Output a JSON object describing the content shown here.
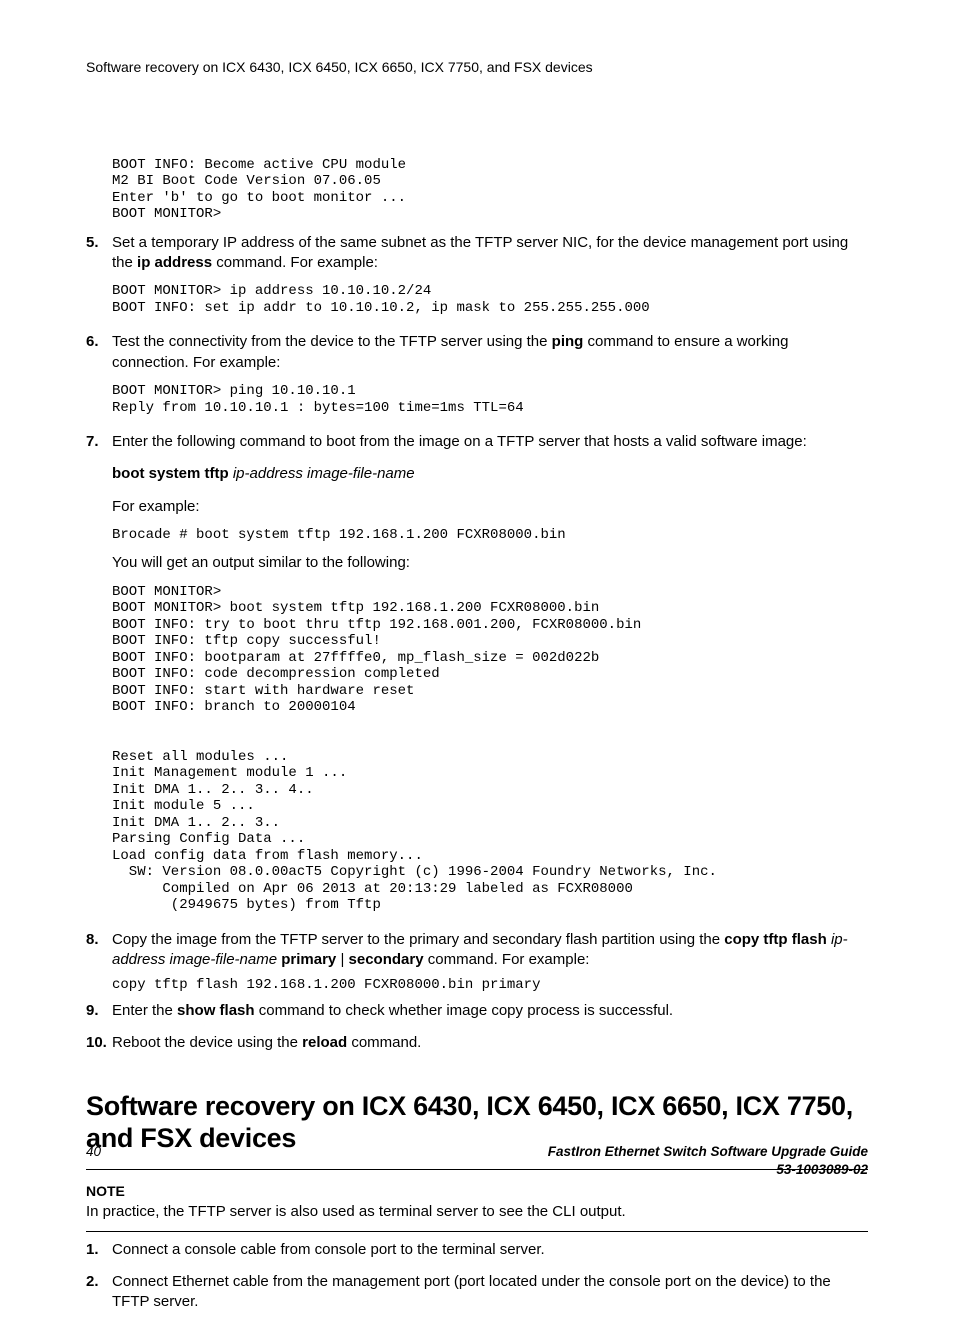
{
  "runningHead": "Software recovery on ICX 6430, ICX 6450, ICX 6650, ICX 7750, and FSX devices",
  "preIntro": "BOOT INFO: Become active CPU module\nM2 BI Boot Code Version 07.06.05\nEnter 'b' to go to boot monitor ...\nBOOT MONITOR>",
  "step5": {
    "num": "5.",
    "text_a": "Set a temporary IP address of the same subnet as the TFTP server NIC, for the device management port using the ",
    "bold_a": "ip address",
    "text_b": " command. For example:",
    "pre": "BOOT MONITOR> ip address 10.10.10.2/24\nBOOT INFO: set ip addr to 10.10.10.2, ip mask to 255.255.255.000"
  },
  "step6": {
    "num": "6.",
    "text_a": "Test the connectivity from the device to the TFTP server using the ",
    "bold_a": "ping",
    "text_b": " command to ensure a working connection. For example:",
    "pre": "BOOT MONITOR> ping 10.10.10.1\nReply from 10.10.10.1 : bytes=100 time=1ms TTL=64"
  },
  "step7": {
    "num": "7.",
    "p1": "Enter the following command to boot from the image on a TFTP server that hosts a valid software image:",
    "cmd_bold": "boot system tftp",
    "cmd_ital": "ip-address image-file-name",
    "p2": "For example:",
    "pre1": "Brocade # boot system tftp 192.168.1.200 FCXR08000.bin",
    "p3": "You will get an output similar to the following:",
    "pre2": "BOOT MONITOR>\nBOOT MONITOR> boot system tftp 192.168.1.200 FCXR08000.bin\nBOOT INFO: try to boot thru tftp 192.168.001.200, FCXR08000.bin\nBOOT INFO: tftp copy successful!\nBOOT INFO: bootparam at 27ffffe0, mp_flash_size = 002d022b\nBOOT INFO: code decompression completed\nBOOT INFO: start with hardware reset\nBOOT INFO: branch to 20000104\n\n\nReset all modules ...\nInit Management module 1 ...\nInit DMA 1.. 2.. 3.. 4..\nInit module 5 ...\nInit DMA 1.. 2.. 3..\nParsing Config Data ...\nLoad config data from flash memory...\n  SW: Version 08.0.00acT5 Copyright (c) 1996-2004 Foundry Networks, Inc.\n      Compiled on Apr 06 2013 at 20:13:29 labeled as FCXR08000\n       (2949675 bytes) from Tftp"
  },
  "step8": {
    "num": "8.",
    "text_a": "Copy the image from the TFTP server to the primary and secondary flash partition using the ",
    "bold_a": "copy tftp flash",
    "ital_a": "ip-address image-file-name",
    "bold_b": "primary",
    "sep": " | ",
    "bold_c": "secondary",
    "text_b": " command. For example:",
    "code": "copy tftp flash 192.168.1.200 FCXR08000.bin primary"
  },
  "step9": {
    "num": "9.",
    "text_a": "Enter the ",
    "bold_a": "show flash",
    "text_b": " command to check whether image copy process is successful."
  },
  "step10": {
    "num": "10.",
    "text_a": "Reboot the device using the ",
    "bold_a": "reload",
    "text_b": " command."
  },
  "sectionTitle": "Software recovery on ICX 6430, ICX 6450, ICX 6650, ICX 7750, and FSX devices",
  "note": {
    "label": "NOTE",
    "text": "In practice, the TFTP server is also used as terminal server to see the CLI output."
  },
  "sec_step1": {
    "num": "1.",
    "text": "Connect a console cable from console port to the terminal server."
  },
  "sec_step2": {
    "num": "2.",
    "text": "Connect Ethernet cable from the management port (port located under the console port on the device) to the TFTP server."
  },
  "footer": {
    "page": "40",
    "title": "FastIron Ethernet Switch Software Upgrade Guide",
    "docnum": "53-1003089-02"
  }
}
